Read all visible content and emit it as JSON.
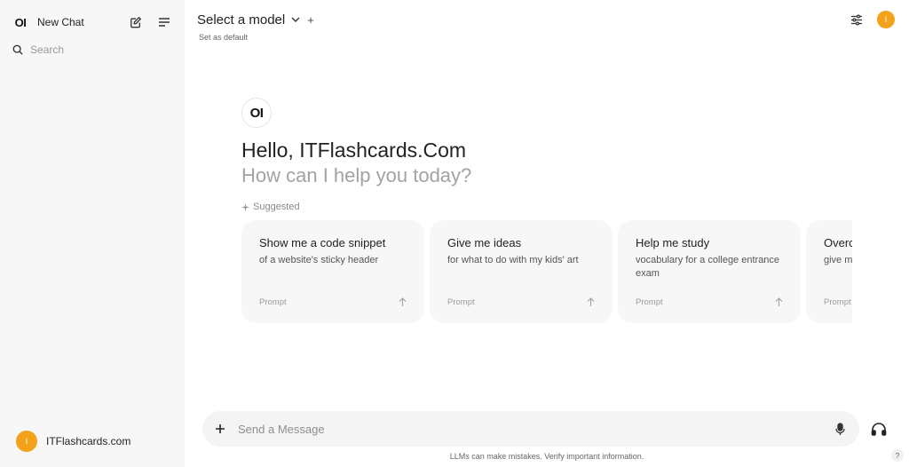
{
  "sidebar": {
    "logo": "OI",
    "new_chat_label": "New Chat",
    "search_placeholder": "Search",
    "user_name": "ITFlashcards.com",
    "user_initial": "I"
  },
  "topbar": {
    "model_title": "Select a model",
    "add_model": "+",
    "set_default": "Set as default",
    "user_initial": "I"
  },
  "welcome": {
    "logo": "OI",
    "greeting": "Hello, ITFlashcards.Com",
    "subtitle": "How can I help you today?",
    "suggested_label": "Suggested"
  },
  "suggestions": [
    {
      "title": "Show me a code snippet",
      "subtitle": "of a website's sticky header",
      "footer": "Prompt"
    },
    {
      "title": "Give me ideas",
      "subtitle": "for what to do with my kids' art",
      "footer": "Prompt"
    },
    {
      "title": "Help me study",
      "subtitle": "vocabulary for a college entrance exam",
      "footer": "Prompt"
    },
    {
      "title": "Overc",
      "subtitle": "give m",
      "footer": "Prompt"
    }
  ],
  "message_bar": {
    "placeholder": "Send a Message"
  },
  "footer": {
    "disclaimer": "LLMs can make mistakes. Verify important information.",
    "help": "?"
  },
  "colors": {
    "sidebar_bg": "#f7f7f7",
    "card_bg": "#f7f7f7",
    "avatar": "#f2a21b",
    "muted_text": "#a3a3a3"
  },
  "icons": [
    "edit-icon",
    "menu-icon",
    "search-icon",
    "chevron-down-icon",
    "settings-sliders-icon",
    "sparkle-icon",
    "arrow-up-icon",
    "plus-icon",
    "mic-icon",
    "headphones-icon"
  ]
}
